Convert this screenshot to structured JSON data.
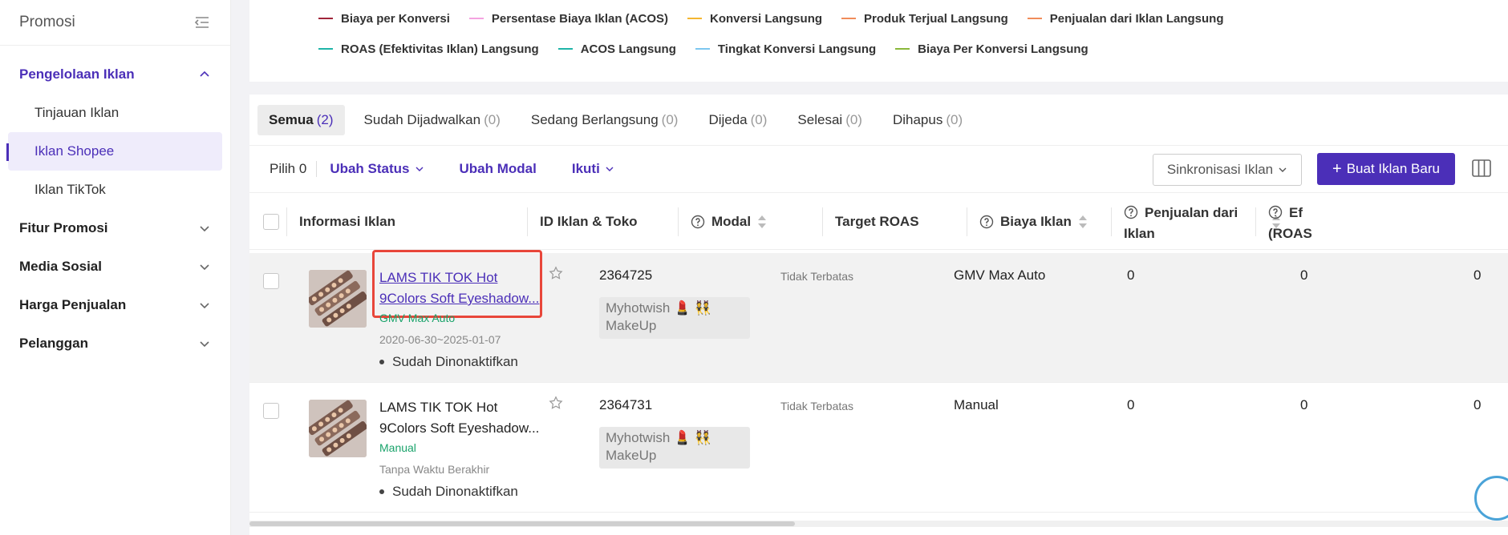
{
  "sidebar": {
    "title": "Promosi",
    "groups": [
      {
        "label": "Pengelolaan Iklan",
        "expanded": true
      },
      {
        "label": "Fitur Promosi"
      },
      {
        "label": "Media Sosial"
      },
      {
        "label": "Harga Penjualan"
      },
      {
        "label": "Pelanggan"
      }
    ],
    "sub_items": [
      "Tinjauan Iklan",
      "Iklan Shopee",
      "Iklan TikTok"
    ],
    "selected_sub": "Iklan Shopee"
  },
  "legend": {
    "row1": [
      {
        "label": "Biaya per Konversi",
        "color": "#a0253a"
      },
      {
        "label": "Persentase Biaya Iklan (ACOS)",
        "color": "#f4a3e0"
      },
      {
        "label": "Konversi Langsung",
        "color": "#f4b631"
      },
      {
        "label": "Produk Terjual Langsung",
        "color": "#f08c5a"
      },
      {
        "label": "Penjualan dari Iklan Langsung",
        "color": "#f08c5a"
      }
    ],
    "row2": [
      {
        "label": "ROAS (Efektivitas Iklan) Langsung",
        "color": "#1fb5a8"
      },
      {
        "label": "ACOS Langsung",
        "color": "#1fb5a8"
      },
      {
        "label": "Tingkat Konversi Langsung",
        "color": "#7dc7f0"
      },
      {
        "label": "Biaya Per Konversi Langsung",
        "color": "#8ab83a"
      }
    ]
  },
  "tabs": [
    {
      "label": "Semua",
      "count": "(2)",
      "active": true
    },
    {
      "label": "Sudah Dijadwalkan",
      "count": "(0)"
    },
    {
      "label": "Sedang Berlangsung",
      "count": "(0)"
    },
    {
      "label": "Dijeda",
      "count": "(0)"
    },
    {
      "label": "Selesai",
      "count": "(0)"
    },
    {
      "label": "Dihapus",
      "count": "(0)"
    }
  ],
  "toolbar": {
    "pilih": "Pilih 0",
    "ubah_status": "Ubah Status",
    "ubah_modal": "Ubah Modal",
    "ikuti": "Ikuti",
    "sync": "Sinkronisasi Iklan",
    "new_ad": "Buat Iklan Baru"
  },
  "columns": {
    "info": "Informasi Iklan",
    "id": "ID Iklan & Toko",
    "modal": "Modal",
    "target": "Target ROAS",
    "biaya": "Biaya Iklan",
    "penjualan_1": "Penjualan dari",
    "penjualan_2": "Iklan",
    "roas_1": "Ef",
    "roas_2": "(ROAS"
  },
  "rows": [
    {
      "title_1": "LAMS TIK TOK Hot",
      "title_2": "9Colors Soft Eyeshadow...",
      "type": "GMV Max Auto",
      "date": "2020-06-30~2025-01-07",
      "status": "Sudah Dinonaktifkan",
      "id": "2364725",
      "shop_1": "Myhotwish 💄 👯",
      "shop_2": "MakeUp",
      "modal": "Tidak Terbatas",
      "target": "GMV Max Auto",
      "biaya": "0",
      "penjualan": "0",
      "roas": "0"
    },
    {
      "title_1": "LAMS TIK TOK Hot",
      "title_2": "9Colors Soft Eyeshadow...",
      "type": "Manual",
      "date": "Tanpa Waktu Berakhir",
      "status": "Sudah Dinonaktifkan",
      "id": "2364731",
      "shop_1": "Myhotwish 💄 👯",
      "shop_2": "MakeUp",
      "modal": "Tidak Terbatas",
      "target": "Manual",
      "biaya": "0",
      "penjualan": "0",
      "roas": "0"
    }
  ]
}
